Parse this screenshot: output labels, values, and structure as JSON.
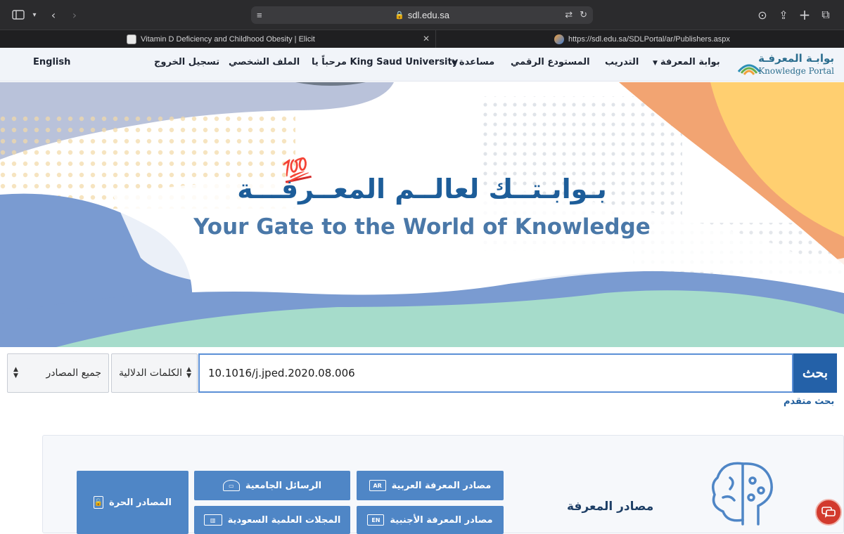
{
  "browser": {
    "url": "sdl.edu.sa",
    "tabs": [
      {
        "title": "Vitamin D Deficiency and Childhood Obesity | Elicit"
      },
      {
        "title": "https://sdl.edu.sa/SDLPortal/ar/Publishers.aspx"
      }
    ]
  },
  "nav": {
    "logo_ar": "بوابـة المعرفـة",
    "logo_en": "Knowledge Portal",
    "portal": "بوابة المعرفة",
    "training": "التدريب",
    "repository": "المستودع الرقمي",
    "help": "مساعدة",
    "welcome": "مرحباً يا King Saud University",
    "profile": "الملف الشخصي",
    "logout": "تسجيل الخروج",
    "language": "English"
  },
  "hero": {
    "emoji": "💯",
    "title_ar": "بـوابـتــك لعالــم المعــرفـــة",
    "title_en": "Your Gate to the World of Knowledge"
  },
  "search": {
    "source_select": "جميع المصادر",
    "field_select": "الكلمات الدلالية",
    "query": "10.1016/j.jped.2020.08.006",
    "button": "بحث",
    "advanced": "بحث متقدم"
  },
  "knowledge": {
    "title": "مصادر المعرفة",
    "buttons": {
      "arabic": "مصادر المعرفة العربية",
      "theses": "الرسائل الجامعية",
      "free": "المصادر الحرة",
      "foreign": "مصادر المعرفة الأجنبية",
      "journals": "المجلات العلمية السعودية"
    },
    "badge_ar": "AR",
    "badge_en": "EN"
  },
  "colors": {
    "primary": "#2461a8",
    "button": "#4f86c6",
    "accent_orange": "#f2a472",
    "accent_yellow": "#ffcf70",
    "accent_teal": "#a6dccb"
  }
}
